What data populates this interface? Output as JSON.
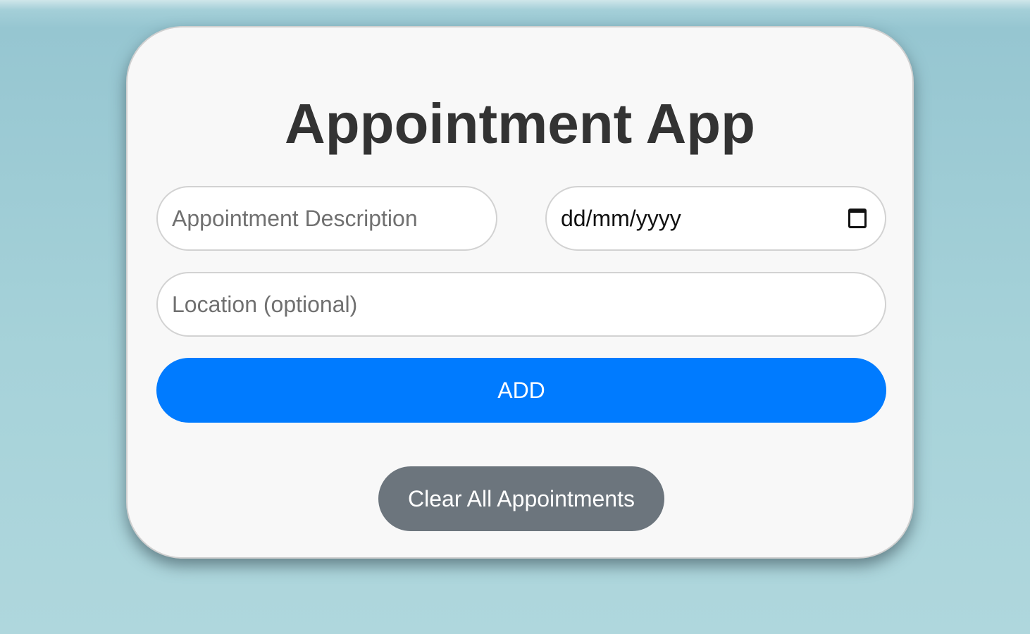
{
  "app": {
    "title": "Appointment App"
  },
  "form": {
    "description": {
      "placeholder": "Appointment Description",
      "value": ""
    },
    "date": {
      "display": "dd/mm/yyyy",
      "icon": "calendar-icon"
    },
    "location": {
      "placeholder": "Location (optional)",
      "value": ""
    },
    "add_label": "ADD"
  },
  "actions": {
    "clear_label": "Clear All Appointments"
  },
  "colors": {
    "primary": "#007bff",
    "secondary": "#6c757d",
    "title": "#333333",
    "card": "#f8f8f8"
  }
}
